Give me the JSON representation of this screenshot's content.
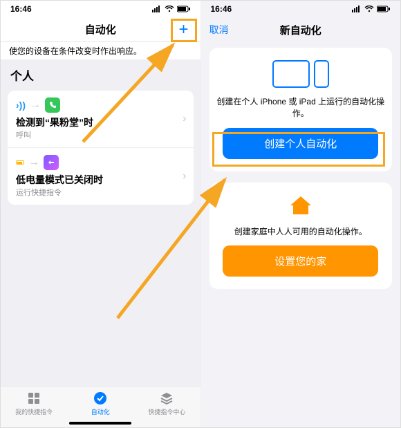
{
  "left": {
    "status": {
      "time": "16:46"
    },
    "nav": {
      "title": "自动化"
    },
    "hint": "使您的设备在条件改变时作出响应。",
    "section_title": "个人",
    "items": [
      {
        "title": "检测到“果粉堂”时",
        "sub": "呼叫"
      },
      {
        "title": "低电量模式已关闭时",
        "sub": "运行快捷指令"
      }
    ],
    "tabs": [
      {
        "label": "我的快捷指令"
      },
      {
        "label": "自动化"
      },
      {
        "label": "快捷指令中心"
      }
    ]
  },
  "right": {
    "status": {
      "time": "16:46"
    },
    "nav": {
      "title": "新自动化",
      "cancel": "取消"
    },
    "personal": {
      "desc": "创建在个人 iPhone 或 iPad 上运行的自动化操作。",
      "button": "创建个人自动化"
    },
    "home": {
      "desc": "创建家庭中人人可用的自动化操作。",
      "button": "设置您的家"
    }
  }
}
